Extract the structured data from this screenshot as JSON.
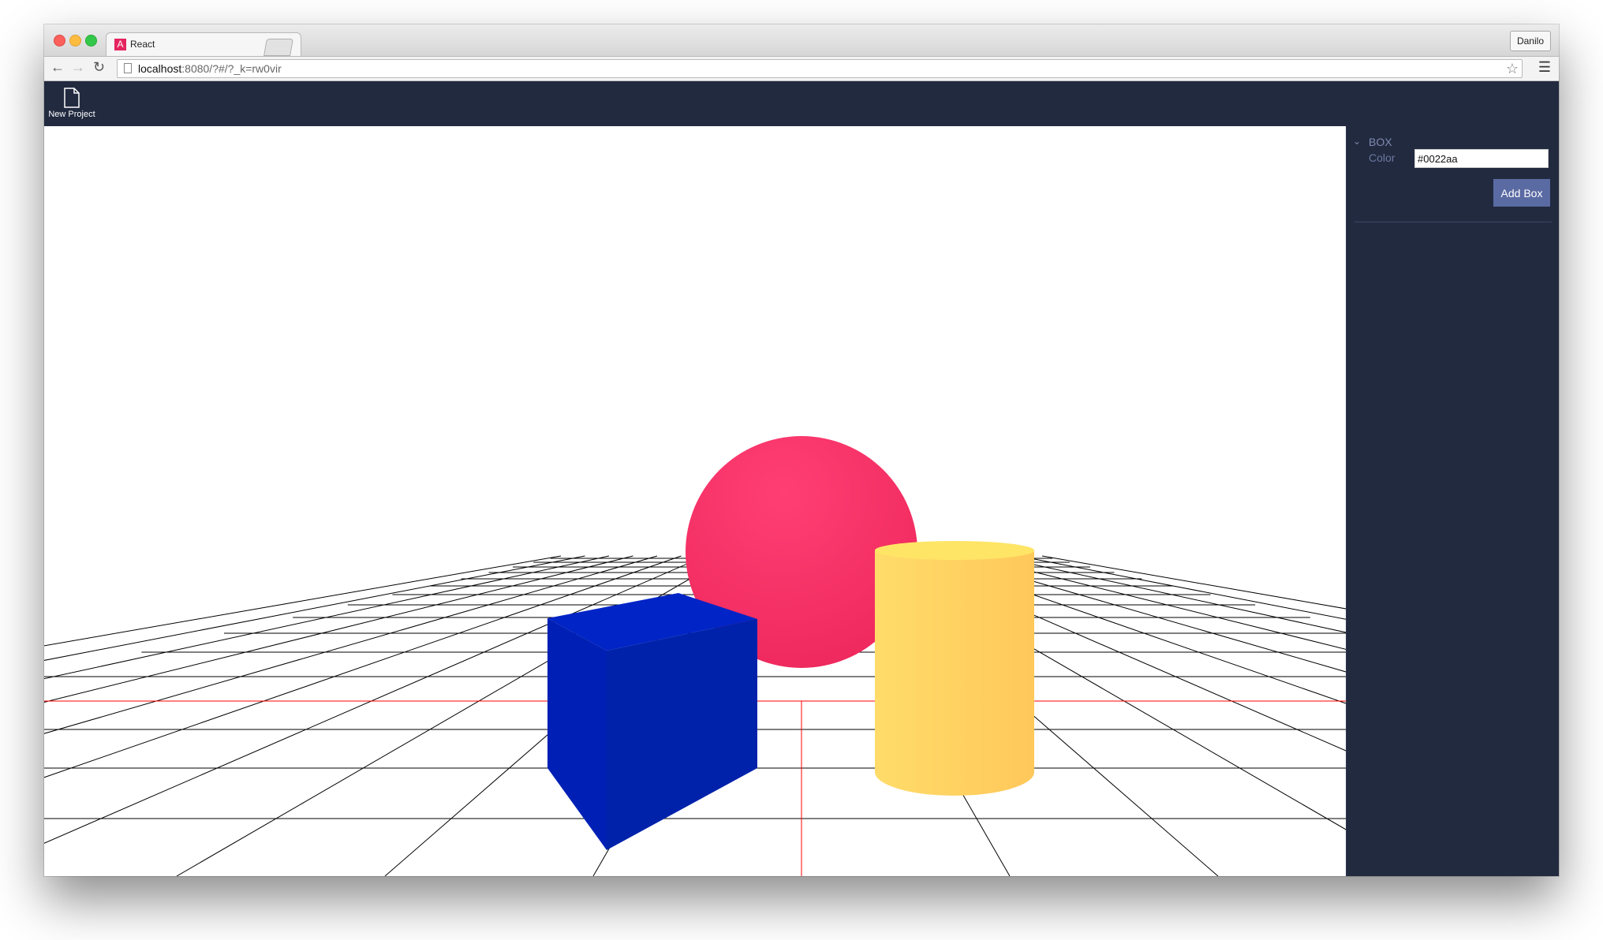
{
  "browser": {
    "tab_title": "React",
    "tab_favicon_letter": "A",
    "profile_name": "Danilo",
    "url_host": "localhost",
    "url_rest": ":8080/?#/?_k=rw0vir"
  },
  "app": {
    "toolbar": {
      "new_project_label": "New Project",
      "new_project_icon": "file-icon"
    },
    "sidebar": {
      "section_title": "BOX",
      "color_label": "Color",
      "color_value": "#0022aa",
      "add_button_label": "Add Box"
    },
    "scene": {
      "objects": [
        {
          "type": "sphere",
          "color": "#ff3366"
        },
        {
          "type": "box",
          "color": "#0022aa"
        },
        {
          "type": "cylinder",
          "color": "#ffd264"
        }
      ],
      "grid_color": "#000000",
      "axis_color": "#ff0000"
    },
    "colors": {
      "header_bg": "#222a40",
      "button_bg": "#5a6aa3",
      "label_color": "#7f8bb0"
    }
  }
}
